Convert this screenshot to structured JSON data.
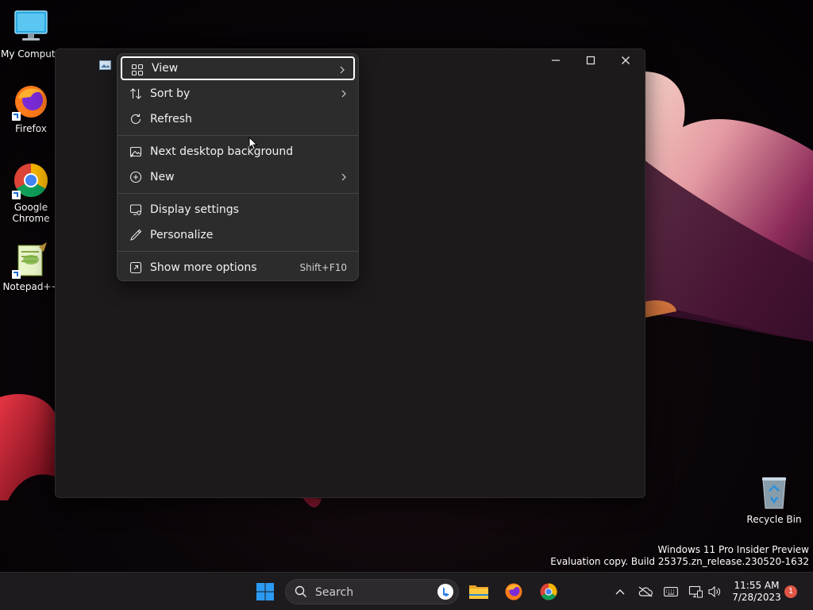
{
  "desktop": {
    "icons": [
      {
        "label": "My Compute"
      },
      {
        "label": "Firefox"
      },
      {
        "label": "Google Chrome"
      },
      {
        "label": "Notepad++"
      },
      {
        "label": "Recycle Bin"
      }
    ]
  },
  "context_menu": {
    "items": [
      {
        "label": "View",
        "icon": "grid-view-icon",
        "submenu": true,
        "focused": true
      },
      {
        "label": "Sort by",
        "icon": "sort-icon",
        "submenu": true
      },
      {
        "label": "Refresh",
        "icon": "refresh-icon"
      },
      {
        "label": "Next desktop background",
        "icon": "next-background-icon"
      },
      {
        "label": "New",
        "icon": "new-plus-icon",
        "submenu": true
      },
      {
        "label": "Display settings",
        "icon": "display-settings-icon"
      },
      {
        "label": "Personalize",
        "icon": "pen-icon"
      },
      {
        "label": "Show more options",
        "icon": "more-options-icon",
        "shortcut": "Shift+F10"
      }
    ]
  },
  "watermark": {
    "line1": "Windows 11 Pro Insider Preview",
    "line2": "Evaluation copy. Build 25375.zn_release.230520-1632"
  },
  "taskbar": {
    "search_placeholder": "Search",
    "clock_time": "11:55 AM",
    "clock_date": "7/28/2023",
    "notification_count": "1"
  },
  "colors": {
    "accent": "#1f6fd1",
    "menu_bg": "#2c2c2c",
    "taskbar_bg": "#1e1b1e",
    "badge": "#e05545"
  }
}
